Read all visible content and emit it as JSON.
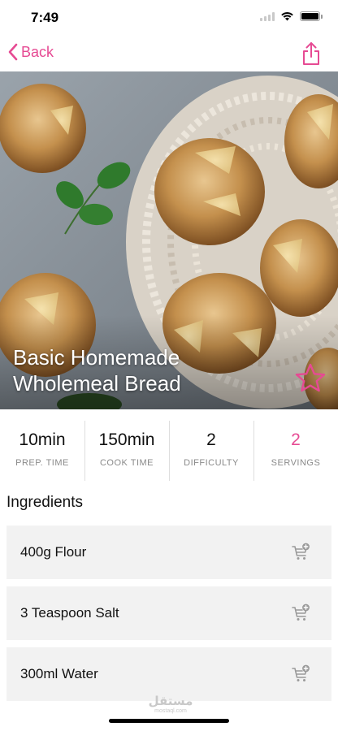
{
  "status_bar": {
    "time": "7:49"
  },
  "nav": {
    "back_label": "Back"
  },
  "recipe": {
    "title": "Basic Homemade Wholemeal Bread",
    "stats": [
      {
        "value": "10min",
        "label": "PREP. TIME"
      },
      {
        "value": "150min",
        "label": "COOK TIME"
      },
      {
        "value": "2",
        "label": "DIFFICULTY"
      },
      {
        "value": "2",
        "label": "SERVINGS"
      }
    ]
  },
  "ingredients": {
    "title": "Ingredients",
    "items": [
      {
        "label": "400g Flour"
      },
      {
        "label": "3 Teaspoon Salt"
      },
      {
        "label": "300ml Water"
      }
    ]
  },
  "watermark": {
    "arabic": "مستقل",
    "latin": "mostaql.com"
  },
  "colors": {
    "accent": "#e64a93",
    "row_bg": "#f2f2f2"
  },
  "icons": {
    "back": "chevron-left-icon",
    "share": "share-icon",
    "favorite": "star-outline-icon",
    "add_to_cart": "cart-plus-icon"
  }
}
